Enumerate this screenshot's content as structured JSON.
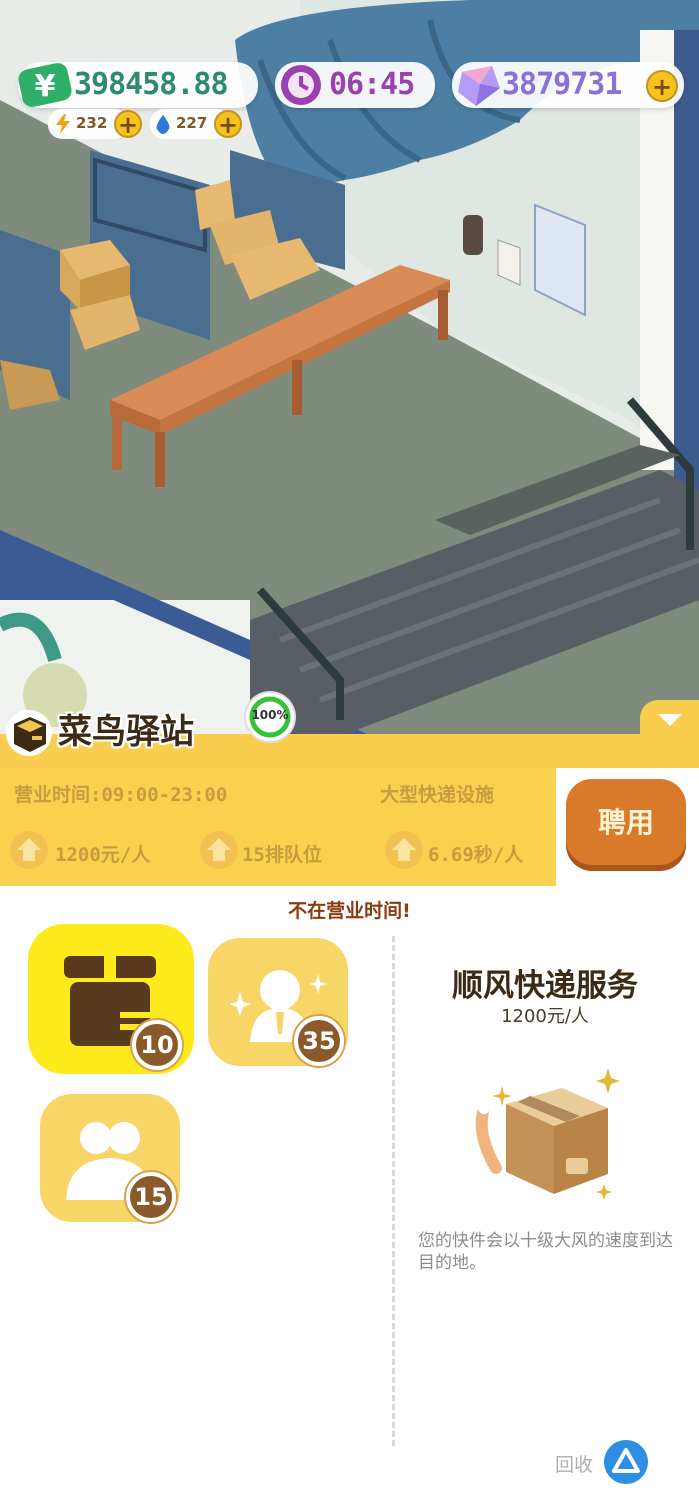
{
  "hud": {
    "money": "398458.88",
    "money_icon": "yuan-icon",
    "time": "06:45",
    "gems": "3879731",
    "energy": "232",
    "water": "227"
  },
  "station": {
    "title": "菜鸟驿站",
    "percent": "100%",
    "hours_label": "营业时间:09:00-23:00",
    "category": "大型快递设施",
    "stats": [
      "1200元/人",
      "15排队位",
      "6.69秒/人"
    ],
    "hire_label": "聘用",
    "closed_notice": "不在营业时间!"
  },
  "upgrades": [
    {
      "name": "package",
      "level": "10",
      "selected": true
    },
    {
      "name": "staff",
      "level": "35",
      "selected": false
    },
    {
      "name": "customers",
      "level": "15",
      "selected": false
    }
  ],
  "detail": {
    "title": "顺风快递服务",
    "price": "1200元/人",
    "description": "您的快件会以十级大风的速度到达目的地。"
  },
  "recycle_label": "回收",
  "colors": {
    "panel_yellow": "#f9cd4e",
    "card_selected": "#fdea1a",
    "card_normal": "#f8d567",
    "hire_button": "#d9792a",
    "notice_text": "#8a3b12"
  }
}
